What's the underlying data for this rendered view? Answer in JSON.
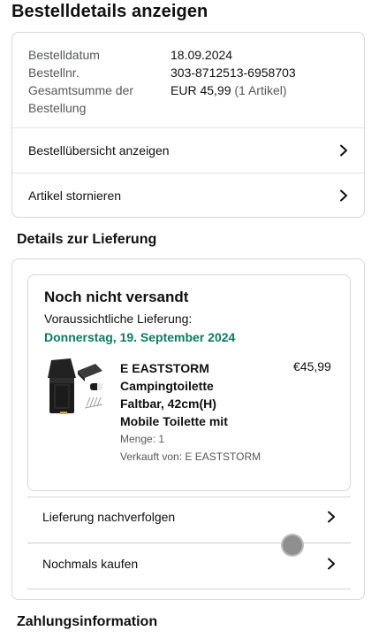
{
  "page_title": "Bestelldetails anzeigen",
  "summary": {
    "order_date_label": "Bestelldatum",
    "order_date": "18.09.2024",
    "order_no_label": "Bestellnr.",
    "order_no": "303-8712513-6958703",
    "total_label_line1": "Gesamtsumme der",
    "total_label_line2": "Bestellung",
    "total_value": "EUR 45,99",
    "total_items": "(1 Artikel)",
    "links": [
      {
        "label": "Bestellübersicht anzeigen"
      },
      {
        "label": "Artikel stornieren"
      }
    ]
  },
  "delivery": {
    "section_title": "Details zur Lieferung",
    "status": "Noch nicht versandt",
    "estimate_label": "Voraussichtliche Lieferung:",
    "estimate_date": "Donnerstag, 19. September 2024",
    "product": {
      "title_lines": [
        "E EASTSTORM",
        "Campingtoilette",
        "Faltbar, 42cm(H)",
        "Mobile Toilette mit"
      ],
      "price": "€45,99",
      "quantity": "Menge: 1",
      "seller": "Verkauft von: E EASTSTORM"
    },
    "actions": [
      {
        "label": "Lieferung nachverfolgen"
      },
      {
        "label": "Nochmals kaufen"
      }
    ]
  },
  "payment": {
    "section_title": "Zahlungsinformation"
  },
  "colors": {
    "accent_green": "#067d62",
    "border": "#d5d9d9",
    "text": "#0f1111",
    "muted": "#565959"
  },
  "icons": {
    "chevron": "chevron-right-icon"
  }
}
